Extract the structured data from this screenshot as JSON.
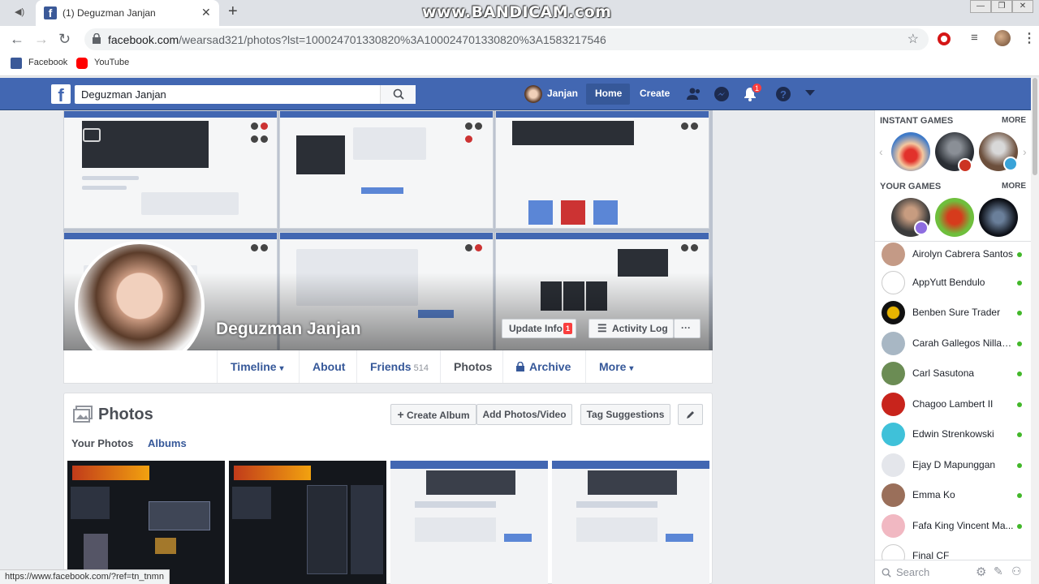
{
  "browser": {
    "tab_title": "(1) Deguzman Janjan",
    "url_host": "facebook.com",
    "url_path": "/wearsad321/photos?lst=100024701330820%3A100024701330820%3A1583217546",
    "watermark": "www.BANDICAM.com",
    "bookmarks": [
      "Facebook",
      "YouTube"
    ],
    "status_url": "https://www.facebook.com/?ref=tn_tnmn"
  },
  "fb_top": {
    "search_value": "Deguzman Janjan",
    "user_name": "Janjan",
    "home": "Home",
    "create": "Create",
    "notif_count": "1"
  },
  "profile": {
    "name": "Deguzman Janjan",
    "update_info": "Update Info",
    "update_badge": "1",
    "activity_log": "Activity Log",
    "more_dots": "···"
  },
  "profile_tabs": [
    {
      "label": "Timeline",
      "suffix": "▾"
    },
    {
      "label": "About"
    },
    {
      "label": "Friends",
      "count": "514"
    },
    {
      "label": "Photos"
    },
    {
      "label": "Archive"
    },
    {
      "label": "More",
      "suffix": "▾"
    }
  ],
  "photos": {
    "title": "Photos",
    "create_album": "Create Album",
    "add_photos": "Add Photos/Video",
    "tag_suggestions": "Tag Suggestions",
    "tab_your": "Your Photos",
    "tab_albums": "Albums"
  },
  "sidebar": {
    "instant_games": "INSTANT GAMES",
    "your_games": "YOUR GAMES",
    "more": "MORE",
    "search_placeholder": "Search",
    "contacts": [
      "Airolyn Cabrera Santos",
      "AppYutt Bendulo",
      "Benben Sure Trader",
      "Carah Gallegos Nillasca",
      "Carl Sasutona",
      "Chagoo Lambert II",
      "Edwin Strenkowski",
      "Ejay D Mapunggan",
      "Emma Ko",
      "Fafa King Vincent Ma...",
      "Final CF"
    ]
  },
  "colors": {
    "fb_blue": "#4267b2",
    "link_blue": "#365899",
    "online_green": "#42b72a",
    "badge_red": "#fa3e3e"
  }
}
